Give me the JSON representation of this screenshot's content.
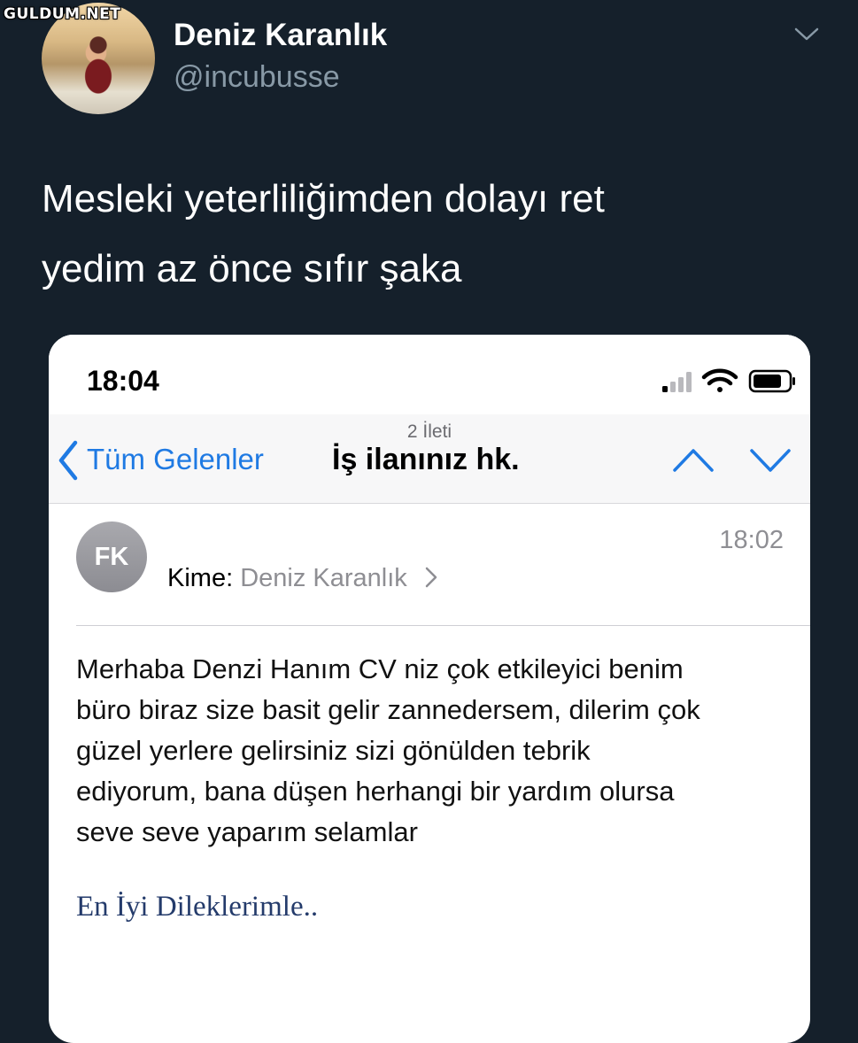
{
  "watermark": "GULDUM.NET",
  "tweet": {
    "author_name": "Deniz Karanlık",
    "author_handle": "@incubusse",
    "text_lines": [
      "Mesleki yeterliliğimden dolayı ret",
      "yedim az önce sıfır şaka"
    ]
  },
  "screenshot": {
    "status_time": "18:04",
    "nav": {
      "back_label": "Tüm Gelenler",
      "thread_count": "2 İleti",
      "subject": "İş ilanınız hk."
    },
    "message": {
      "sender_initials": "FK",
      "time": "18:02",
      "to_label": "Kime:",
      "to_value": "Deniz Karanlık",
      "body_lines": [
        "Merhaba Denzi Hanım CV niz çok etkileyici benim",
        "büro biraz size basit gelir zannedersem, dilerim çok",
        "güzel yerlere gelirsiniz sizi gönülden tebrik",
        "ediyorum, bana düşen herhangi bir yardım olursa",
        "seve seve yaparım selamlar"
      ],
      "signature": "En İyi Dileklerimle.."
    }
  },
  "colors": {
    "background": "#15202b",
    "handle": "#8899a6",
    "ios_blue": "#1f7ae3",
    "signature": "#243b6b"
  },
  "icons": [
    "chevron-down-icon",
    "signal-icon",
    "wifi-icon",
    "battery-icon",
    "back-chevron-icon",
    "chevron-up-icon",
    "chevron-right-icon"
  ]
}
